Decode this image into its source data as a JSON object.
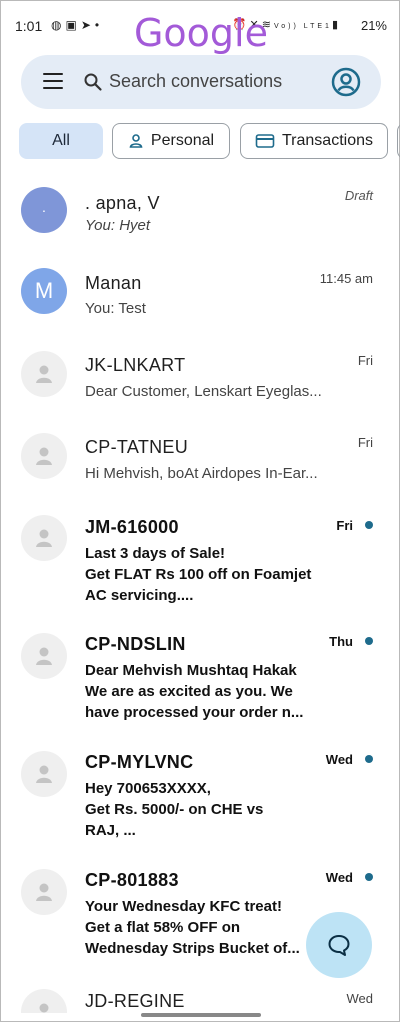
{
  "status_bar": {
    "time": "1:01",
    "left_icons": [
      "whatsapp-icon",
      "gallery-icon",
      "telegram-icon",
      "dot-icon"
    ],
    "right_icons": [
      "alarm-icon",
      "mute-icon",
      "wifi-icon",
      "volte-icon",
      "signal-icon"
    ],
    "volte": "Vo)) LTE1",
    "battery": "21%"
  },
  "brand": {
    "text": "Google",
    "color": "#a35ad8"
  },
  "search": {
    "placeholder": "Search conversations",
    "menu_icon": "hamburger-icon",
    "search_icon": "search-icon",
    "account_icon": "account-icon"
  },
  "chips": [
    {
      "label": "All",
      "selected": true
    },
    {
      "label": "Personal",
      "icon": "person-icon"
    },
    {
      "label": "Transactions",
      "icon": "card-icon"
    }
  ],
  "conversations": [
    {
      "name": ". apna, V",
      "snippet": "You: Hyet",
      "time": "Draft",
      "avatar": "·",
      "unread": false
    },
    {
      "name": "Manan",
      "snippet": "You: Test",
      "time": "11:45 am",
      "avatar": "M",
      "unread": false
    },
    {
      "name": "JK-LNKART",
      "snippet": "Dear Customer, Lenskart Eyeglas...",
      "time": "Fri",
      "unread": false
    },
    {
      "name": "CP-TATNEU",
      "snippet": "Hi Mehvish, boAt Airdopes In-Ear...",
      "time": "Fri",
      "unread": false
    },
    {
      "name": "JM-616000",
      "snippet": "Last 3 days of Sale!\nGet FLAT Rs 100 off on Foamjet\nAC servicing....",
      "time": "Fri",
      "unread": true
    },
    {
      "name": "CP-NDSLIN",
      "snippet": "Dear Mehvish Mushtaq Hakak\nWe are as excited as you. We\nhave processed your order n...",
      "time": "Thu",
      "unread": true
    },
    {
      "name": "CP-MYLVNC",
      "snippet": "Hey 700653XXXX,\n Get Rs. 5000/- on CHE vs\nRAJ, ...",
      "time": "Wed",
      "unread": true
    },
    {
      "name": "CP-801883",
      "snippet": "Your Wednesday KFC treat!\nGet a flat 58% OFF on\nWednesday Strips Bucket of...",
      "time": "Wed",
      "unread": true
    },
    {
      "name": "JD-REGINE",
      "snippet": "",
      "time": "Wed",
      "unread": false
    }
  ],
  "fab": {
    "icon": "start-chat-icon",
    "color": "#bde3f5"
  },
  "colors": {
    "accent": "#1e6b8c",
    "search_bg": "#e4ecf6",
    "chip_selected": "#d5e4f7"
  }
}
